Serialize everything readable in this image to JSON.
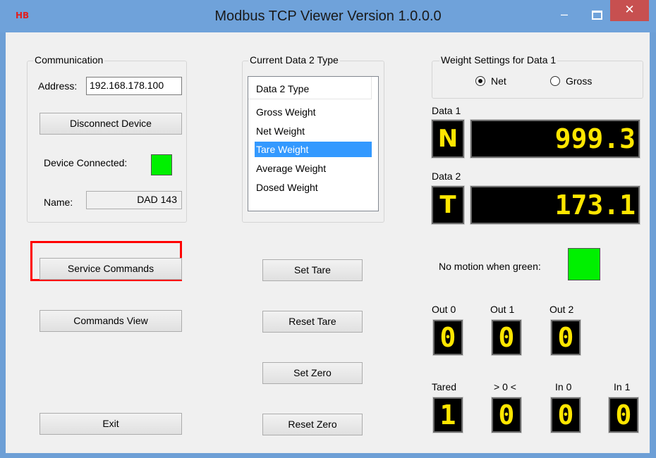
{
  "window": {
    "logo": "HB",
    "title": "Modbus TCP Viewer Version 1.0.0.0",
    "minimize": "–",
    "close": "✕"
  },
  "communication": {
    "legend": "Communication",
    "address_label": "Address:",
    "address_value": "192.168.178.100",
    "disconnect_button": "Disconnect Device",
    "connected_label": "Device Connected:",
    "name_label": "Name:",
    "name_value": "DAD 143"
  },
  "data2type": {
    "legend": "Current Data 2 Type",
    "header": "Data 2 Type",
    "items": [
      "Gross Weight",
      "Net Weight",
      "Tare Weight",
      "Average Weight",
      "Dosed Weight"
    ],
    "selected": "Tare Weight"
  },
  "weight_settings": {
    "legend": "Weight Settings for Data 1",
    "net_label": "Net",
    "gross_label": "Gross",
    "selected": "Net"
  },
  "data1": {
    "label": "Data 1",
    "letter": "N",
    "value": "999.3"
  },
  "data2": {
    "label": "Data 2",
    "letter": "T",
    "value": "173.1"
  },
  "buttons": {
    "service_commands": "Service Commands",
    "commands_view": "Commands View",
    "exit": "Exit",
    "set_tare": "Set Tare",
    "reset_tare": "Reset Tare",
    "set_zero": "Set Zero",
    "reset_zero": "Reset Zero"
  },
  "motion": {
    "label": "No motion when green:"
  },
  "outputs": [
    {
      "label": "Out 0",
      "value": "0"
    },
    {
      "label": "Out 1",
      "value": "0"
    },
    {
      "label": "Out 2",
      "value": "0"
    }
  ],
  "inputs": [
    {
      "label": "Tared",
      "value": "1"
    },
    {
      "label": "> 0 <",
      "value": "0"
    },
    {
      "label": "In 0",
      "value": "0"
    },
    {
      "label": "In 1",
      "value": "0"
    }
  ],
  "colors": {
    "titlebar": "#6fa2da",
    "close_button": "#c75050",
    "led_green": "#00f000",
    "display_text": "#ffe600",
    "highlight": "#ff0000",
    "selection": "#3399ff"
  }
}
